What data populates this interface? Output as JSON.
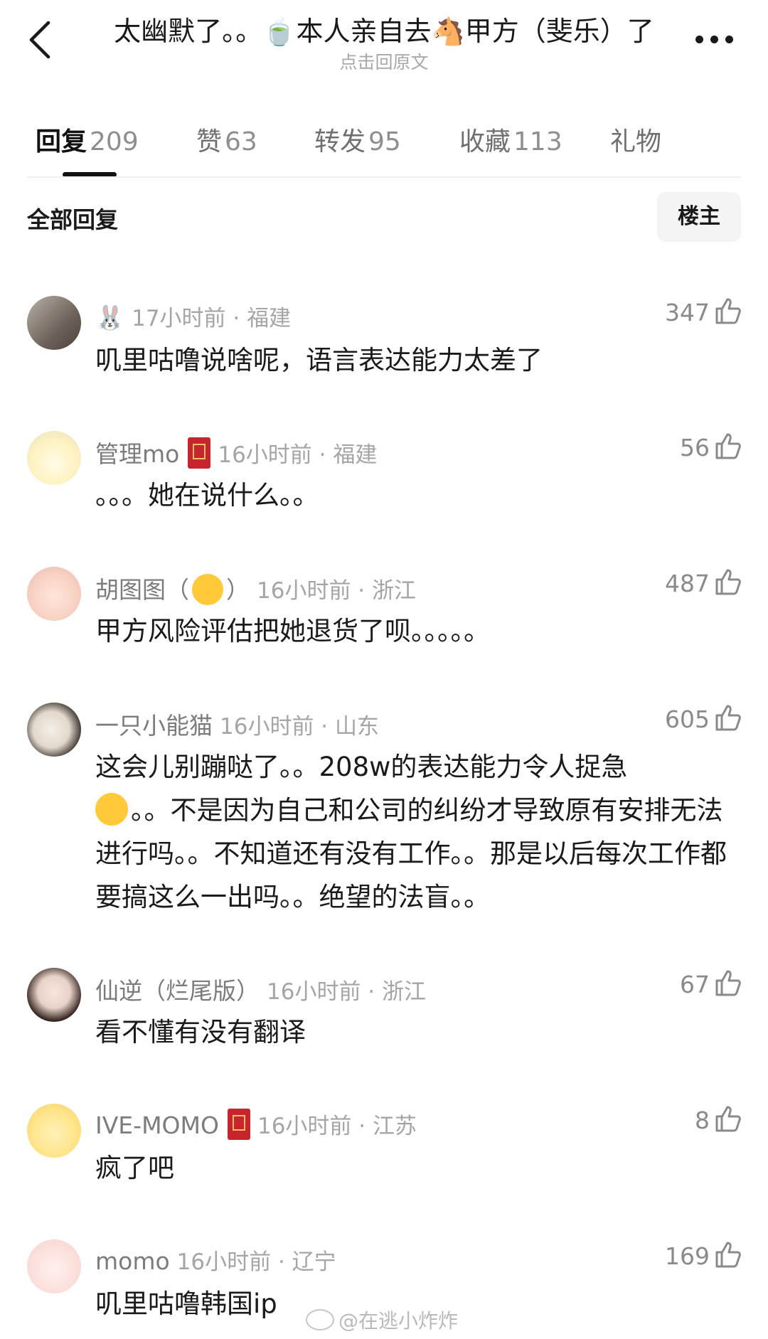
{
  "header": {
    "title": "太幽默了。。🍵本人亲自去🐴甲方（斐乐）了",
    "subtitle": "点击回原文"
  },
  "tabs": [
    {
      "label": "回复",
      "count": "209"
    },
    {
      "label": "赞",
      "count": "63"
    },
    {
      "label": "转发",
      "count": "95"
    },
    {
      "label": "收藏",
      "count": "113"
    },
    {
      "label": "礼物",
      "count": ""
    }
  ],
  "section": {
    "title": "全部回复",
    "op_button": "楼主"
  },
  "comments": [
    {
      "username": "🐰",
      "time": "17小时前 · 福建",
      "likes": "347",
      "text": "叽里咕噜说啥呢，语言表达能力太差了"
    },
    {
      "username": "管理mo",
      "time": "16小时前 · 福建",
      "likes": "56",
      "text": "。。。她在说什么。。"
    },
    {
      "username": "胡图图（",
      "username_after": "）",
      "time": "16小时前 · 浙江",
      "likes": "487",
      "text": "甲方风险评估把她退货了呗。。。。。"
    },
    {
      "username": "一只小能猫",
      "time": "16小时前 · 山东",
      "likes": "605",
      "text_line1": "这会儿别蹦哒了。。208w的表达能力令人捉急",
      "text_rest": "。。不是因为自己和公司的纠纷才导致原有安排无法进行吗。。不知道还有没有工作。。那是以后每次工作都要搞这么一出吗。。绝望的法盲。。"
    },
    {
      "username": "仙逆（烂尾版）",
      "time": "16小时前 · 浙江",
      "likes": "67",
      "text": "看不懂有没有翻译"
    },
    {
      "username": "IVE-MOMO",
      "time": "16小时前 · 江苏",
      "likes": "8",
      "text": "疯了吧"
    },
    {
      "username": "momo",
      "time": "16小时前 · 辽宁",
      "likes": "169",
      "text": "叽里咕噜韩国ip"
    }
  ],
  "watermark": "@在逃小炸炸",
  "colors": {
    "badge": "#c8242d",
    "muted": "#8e8e8e"
  }
}
